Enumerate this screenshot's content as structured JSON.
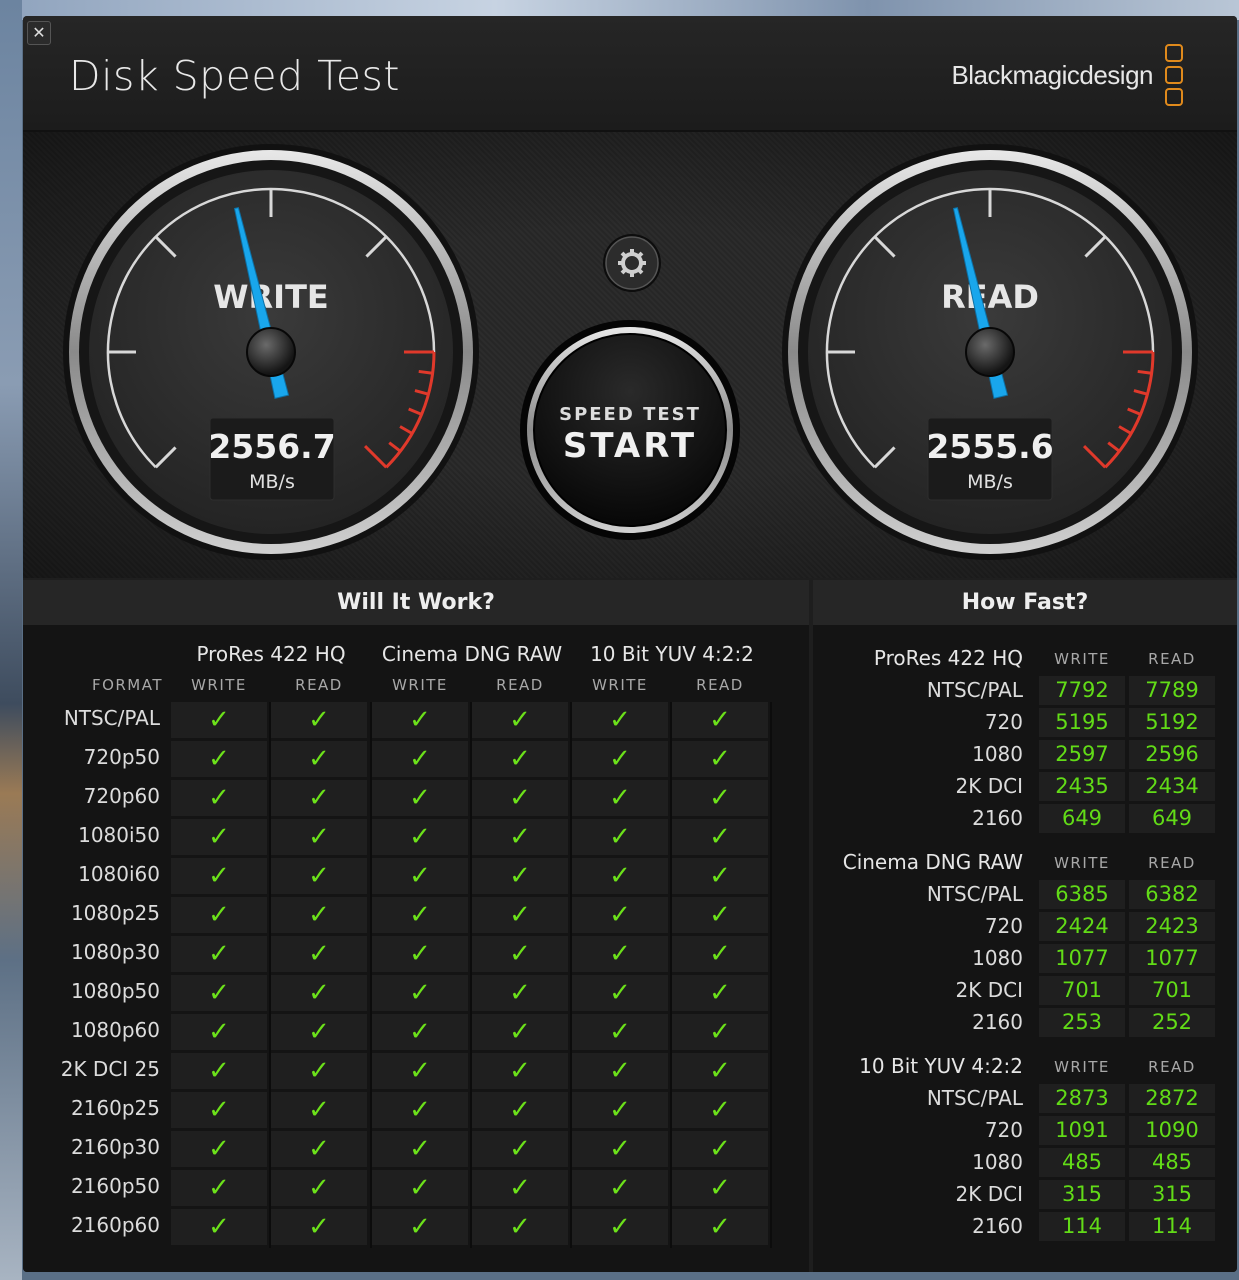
{
  "app": {
    "title": "Disk Speed Test",
    "brand": "Blackmagicdesign",
    "close_glyph": "✕"
  },
  "gauges": {
    "write": {
      "label": "WRITE",
      "value": "2556.7",
      "unit": "MB/s",
      "needle_fraction": 0.45
    },
    "read": {
      "label": "READ",
      "value": "2555.6",
      "unit": "MB/s",
      "needle_fraction": 0.45
    },
    "start": {
      "top": "SPEED TEST",
      "main": "START"
    },
    "settings_icon": "gear-icon"
  },
  "will_it_work": {
    "title": "Will It Work?",
    "format_label": "FORMAT",
    "write_label": "WRITE",
    "read_label": "READ",
    "codecs": [
      "ProRes 422 HQ",
      "Cinema DNG RAW",
      "10 Bit YUV 4:2:2"
    ],
    "formats": [
      "NTSC/PAL",
      "720p50",
      "720p60",
      "1080i50",
      "1080i60",
      "1080p25",
      "1080p30",
      "1080p50",
      "1080p60",
      "2K DCI 25",
      "2160p25",
      "2160p30",
      "2160p50",
      "2160p60"
    ],
    "check_glyph": "✓"
  },
  "how_fast": {
    "title": "How Fast?",
    "write_label": "WRITE",
    "read_label": "READ",
    "groups": [
      {
        "codec": "ProRes 422 HQ",
        "rows": [
          {
            "format": "NTSC/PAL",
            "write": "7792",
            "read": "7789"
          },
          {
            "format": "720",
            "write": "5195",
            "read": "5192"
          },
          {
            "format": "1080",
            "write": "2597",
            "read": "2596"
          },
          {
            "format": "2K DCI",
            "write": "2435",
            "read": "2434"
          },
          {
            "format": "2160",
            "write": "649",
            "read": "649"
          }
        ]
      },
      {
        "codec": "Cinema DNG RAW",
        "rows": [
          {
            "format": "NTSC/PAL",
            "write": "6385",
            "read": "6382"
          },
          {
            "format": "720",
            "write": "2424",
            "read": "2423"
          },
          {
            "format": "1080",
            "write": "1077",
            "read": "1077"
          },
          {
            "format": "2K DCI",
            "write": "701",
            "read": "701"
          },
          {
            "format": "2160",
            "write": "253",
            "read": "252"
          }
        ]
      },
      {
        "codec": "10 Bit YUV 4:2:2",
        "rows": [
          {
            "format": "NTSC/PAL",
            "write": "2873",
            "read": "2872"
          },
          {
            "format": "720",
            "write": "1091",
            "read": "1090"
          },
          {
            "format": "1080",
            "write": "485",
            "read": "485"
          },
          {
            "format": "2K DCI",
            "write": "315",
            "read": "315"
          },
          {
            "format": "2160",
            "write": "114",
            "read": "114"
          }
        ]
      }
    ]
  },
  "colors": {
    "accent_green": "#6ce11a",
    "needle_blue": "#1aa3e8",
    "redline": "#e0392b",
    "brand_orange": "#e08a1c"
  }
}
